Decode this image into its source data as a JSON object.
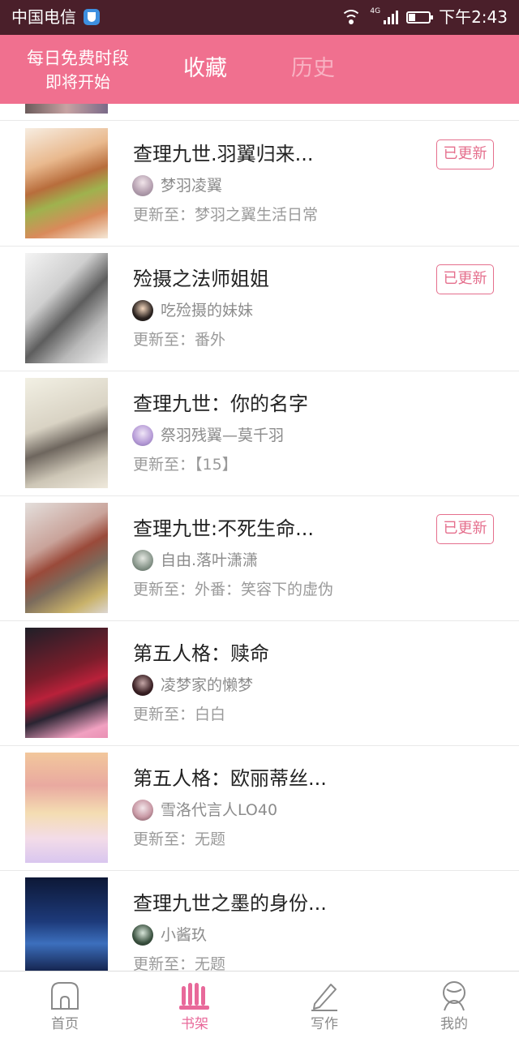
{
  "status_bar": {
    "carrier": "中国电信",
    "network": "4G",
    "time": "下午2:43"
  },
  "header": {
    "free_slot_line1": "每日免费时段",
    "free_slot_line2": "即将开始",
    "tabs": [
      {
        "label": "收藏",
        "active": true
      },
      {
        "label": "历史",
        "active": false
      }
    ],
    "accent_color": "#f0708f"
  },
  "books": [
    {
      "title": "查理九世.羽翼归来...",
      "author": "梦羽凌翼",
      "update_label": "更新至：",
      "update_text": "梦羽之翼生活日常",
      "badge": "已更新"
    },
    {
      "title": "殓摄之法师姐姐",
      "author": "吃殓摄的妹妹",
      "update_label": "更新至：",
      "update_text": "番外",
      "badge": "已更新"
    },
    {
      "title": "查理九世：你的名字",
      "author": "祭羽残翼—莫千羽",
      "update_label": "更新至：",
      "update_text": "【15】",
      "badge": ""
    },
    {
      "title": "查理九世:不死生命...",
      "author": "自由.落叶潇潇",
      "update_label": "更新至：",
      "update_text": "外番：笑容下的虚伪",
      "badge": "已更新"
    },
    {
      "title": "第五人格：赎命",
      "author": "凌梦家的懒梦",
      "update_label": "更新至：",
      "update_text": "白白",
      "badge": ""
    },
    {
      "title": "第五人格：欧丽蒂丝...",
      "author": "雪洛代言人LO40",
      "update_label": "更新至：",
      "update_text": "无题",
      "badge": ""
    },
    {
      "title": "查理九世之墨的身份...",
      "author": "小酱玖",
      "update_label": "更新至：",
      "update_text": "无题",
      "badge": ""
    }
  ],
  "bottom_nav": [
    {
      "label": "首页",
      "icon": "home-icon",
      "active": false
    },
    {
      "label": "书架",
      "icon": "bookshelf-icon",
      "active": true
    },
    {
      "label": "写作",
      "icon": "pencil-icon",
      "active": false
    },
    {
      "label": "我的",
      "icon": "profile-icon",
      "active": false
    }
  ],
  "active_color": "#e8699a"
}
